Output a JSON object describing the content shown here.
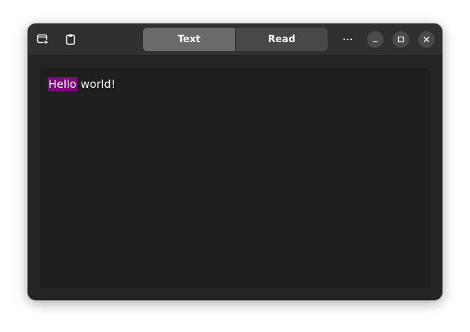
{
  "header": {
    "view_tabs": [
      {
        "label": "Text",
        "active": true
      },
      {
        "label": "Read",
        "active": false
      }
    ],
    "menu_label": "···",
    "icons": [
      "new-window-icon",
      "clipboard-icon",
      "more-menu-icon",
      "minimize-icon",
      "maximize-icon",
      "close-icon"
    ]
  },
  "editor": {
    "highlighted_word": "Hello",
    "rest_text": " world!",
    "highlight_color": "#800080"
  }
}
